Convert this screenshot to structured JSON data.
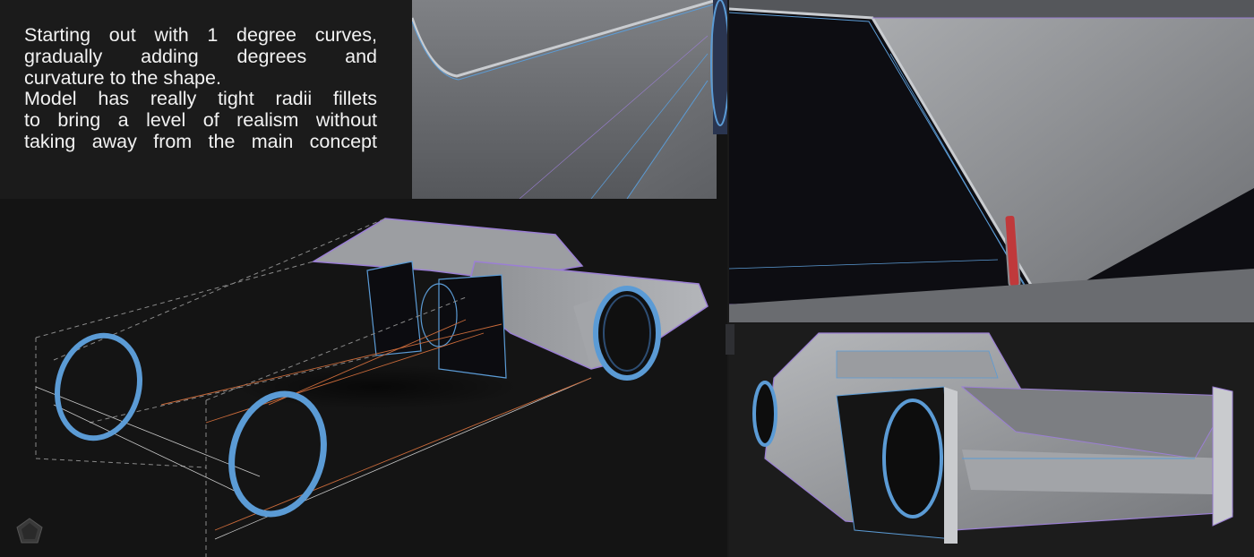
{
  "caption": {
    "lines": [
      "Starting out with 1 degree curves,",
      "gradually adding degrees and",
      "curvature to the shape.",
      "Model has really tight radii fillets",
      "to  bring a level of realism without",
      "taking away from the main concept"
    ]
  },
  "colors": {
    "background": "#1a1a1a",
    "caption_text": "#f2f2f2",
    "surface_grey": "#8a8c90",
    "wire_blue": "#5b9bd5",
    "wire_purple": "#9b7fd4",
    "wire_orange": "#c96a3a",
    "taillight_red": "#c0393b"
  },
  "panels": [
    {
      "id": "caption-panel",
      "content": "text"
    },
    {
      "id": "closeup-panel",
      "content": "render of body panel edge and wheel"
    },
    {
      "id": "interior-panel",
      "content": "render of cabin interior edge with red light"
    },
    {
      "id": "wireframe-panel",
      "content": "3D car model with construction wireframe"
    },
    {
      "id": "rear-panel",
      "content": "rear three-quarter render of car model"
    }
  ],
  "icons": [
    "pentastar-logo-icon"
  ]
}
